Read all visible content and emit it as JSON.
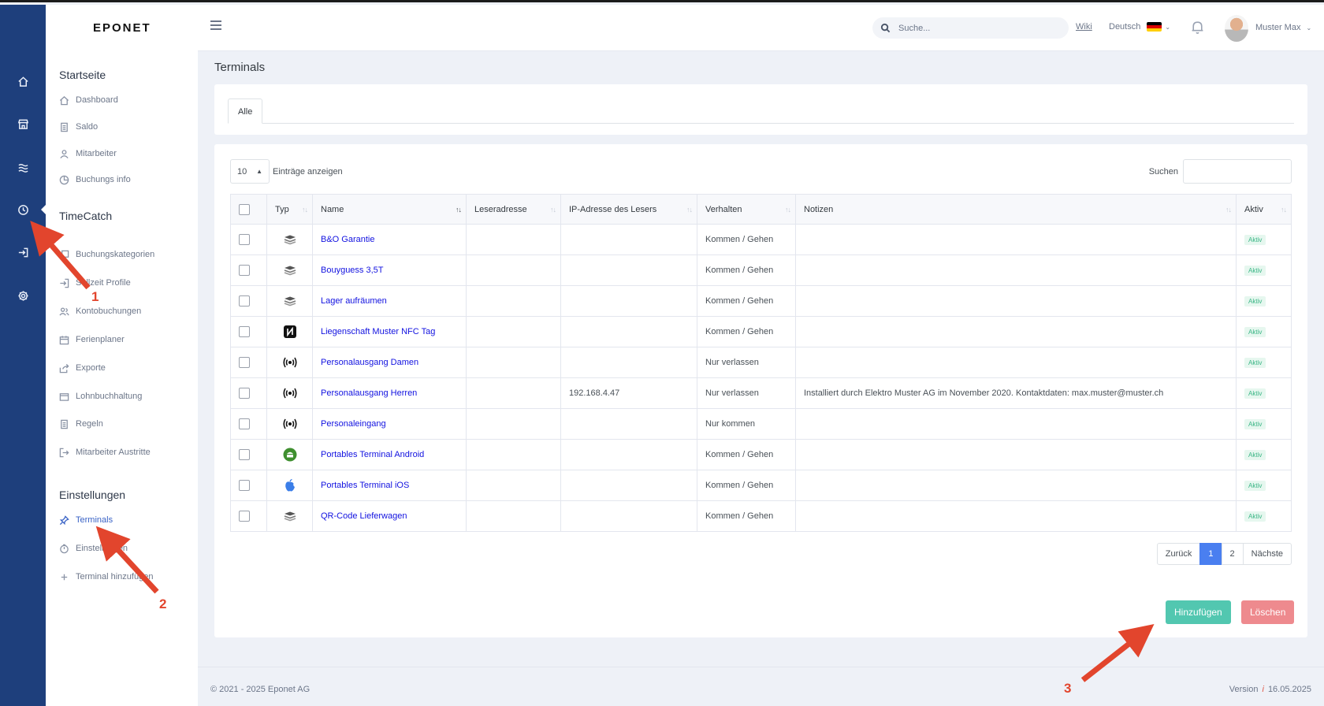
{
  "brand": {
    "logo_text": "EPONET"
  },
  "rail": {
    "items": [
      "home-icon",
      "store-icon",
      "waves-icon",
      "clock-icon",
      "login-icon",
      "gear-icon"
    ],
    "active": "clock-icon"
  },
  "sidebar": {
    "sections": [
      {
        "title": "Startseite",
        "items": [
          "Dashboard",
          "Saldo",
          "Mitarbeiter",
          "Buchungs info"
        ]
      },
      {
        "title": "TimeCatch",
        "items": [
          "Buchungskategorien",
          "Sollzeit Profile",
          "Kontobuchungen",
          "Ferienplaner",
          "Exporte",
          "Lohnbuchhaltung",
          "Regeln",
          "Mitarbeiter Austritte"
        ]
      },
      {
        "title": "Einstellungen",
        "items": [
          "Terminals",
          "Einstellungen",
          "Terminal hinzufügen"
        ]
      }
    ],
    "active_item": "Terminals"
  },
  "topbar": {
    "search_placeholder": "Suche...",
    "wiki": "Wiki",
    "language": "Deutsch",
    "user": "Muster Max"
  },
  "page": {
    "title": "Terminals",
    "tab": "Alle"
  },
  "table_controls": {
    "length_value": "10",
    "length_label": "Einträge anzeigen",
    "search_label": "Suchen"
  },
  "table": {
    "columns": [
      "Typ",
      "Name",
      "Leseradresse",
      "IP-Adresse des Lesers",
      "Verhalten",
      "Notizen",
      "Aktiv"
    ],
    "rows": [
      {
        "type": "stack-icon",
        "name": "B&O Garantie",
        "reader": "",
        "ip": "",
        "behavior": "Kommen / Gehen",
        "notes": "",
        "active": "Aktiv"
      },
      {
        "type": "stack-icon",
        "name": "Bouyguess 3,5T",
        "reader": "",
        "ip": "",
        "behavior": "Kommen / Gehen",
        "notes": "",
        "active": "Aktiv"
      },
      {
        "type": "stack-icon",
        "name": "Lager aufräumen",
        "reader": "",
        "ip": "",
        "behavior": "Kommen / Gehen",
        "notes": "",
        "active": "Aktiv"
      },
      {
        "type": "nfc-icon",
        "name": "Liegenschaft Muster NFC Tag",
        "reader": "",
        "ip": "",
        "behavior": "Kommen / Gehen",
        "notes": "",
        "active": "Aktiv"
      },
      {
        "type": "signal-icon",
        "name": "Personalausgang Damen",
        "reader": "",
        "ip": "",
        "behavior": "Nur verlassen",
        "notes": "",
        "active": "Aktiv"
      },
      {
        "type": "signal-icon",
        "name": "Personalausgang Herren",
        "reader": "",
        "ip": "192.168.4.47",
        "behavior": "Nur verlassen",
        "notes": "Installiert durch Elektro Muster AG im November 2020. Kontaktdaten: max.muster@muster.ch",
        "active": "Aktiv"
      },
      {
        "type": "signal-icon",
        "name": "Personaleingang",
        "reader": "",
        "ip": "",
        "behavior": "Nur kommen",
        "notes": "",
        "active": "Aktiv"
      },
      {
        "type": "android-icon",
        "name": "Portables Terminal Android",
        "reader": "",
        "ip": "",
        "behavior": "Kommen / Gehen",
        "notes": "",
        "active": "Aktiv"
      },
      {
        "type": "apple-icon",
        "name": "Portables Terminal iOS",
        "reader": "",
        "ip": "",
        "behavior": "Kommen / Gehen",
        "notes": "",
        "active": "Aktiv"
      },
      {
        "type": "stack-icon",
        "name": "QR-Code Lieferwagen",
        "reader": "",
        "ip": "",
        "behavior": "Kommen / Gehen",
        "notes": "",
        "active": "Aktiv"
      }
    ]
  },
  "pagination": {
    "prev": "Zurück",
    "pages": [
      "1",
      "2"
    ],
    "current": "1",
    "next": "Nächste"
  },
  "actions": {
    "add": "Hinzufügen",
    "delete": "Löschen"
  },
  "footer": {
    "copyright": "© 2021 - 2025 Eponet AG",
    "version_label": "Version",
    "version_info": "i",
    "version_date": "16.05.2025"
  },
  "annotations": [
    "1",
    "2",
    "3"
  ],
  "colors": {
    "rail": "#1e3f7c",
    "accent": "#4a7ff0",
    "add": "#52c7b0",
    "delete": "#ee8a8e",
    "arrow": "#e2452d"
  }
}
